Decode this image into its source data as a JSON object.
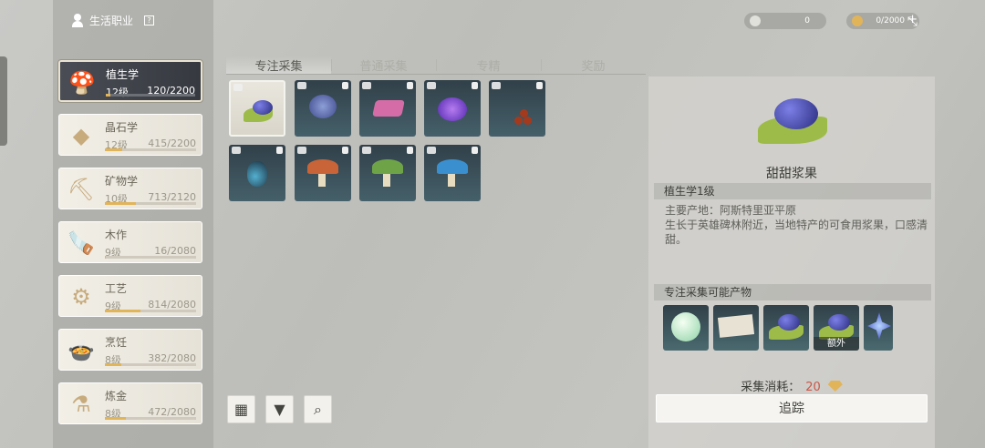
{
  "header": {
    "title": "生活职业",
    "help": "?"
  },
  "resources": [
    {
      "value": "0",
      "icon": "ore-icon",
      "color": "#e1e1dc"
    },
    {
      "value": "0/2000",
      "icon": "diamond-icon",
      "color": "#e2b45a",
      "plus": "+"
    }
  ],
  "fullscreen_icon": "fullscreen-icon",
  "skills": [
    {
      "name": "植生学",
      "level": "12级",
      "xp": "120/2200",
      "progress": 0.055,
      "icon": "mushroom-icon",
      "active": true
    },
    {
      "name": "晶石学",
      "level": "12级",
      "xp": "415/2200",
      "progress": 0.19,
      "icon": "crystal-icon"
    },
    {
      "name": "矿物学",
      "level": "10级",
      "xp": "713/2120",
      "progress": 0.34,
      "icon": "pickaxe-icon"
    },
    {
      "name": "木作",
      "level": "9级",
      "xp": "16/2080",
      "progress": 0.01,
      "icon": "saw-icon"
    },
    {
      "name": "工艺",
      "level": "9级",
      "xp": "814/2080",
      "progress": 0.39,
      "icon": "craft-icon"
    },
    {
      "name": "烹饪",
      "level": "8级",
      "xp": "382/2080",
      "progress": 0.18,
      "icon": "pot-icon"
    },
    {
      "name": "炼金",
      "level": "8级",
      "xp": "472/2080",
      "progress": 0.23,
      "icon": "flask-icon"
    }
  ],
  "tabs": [
    {
      "label": "专注采集",
      "active": true
    },
    {
      "label": "普通采集"
    },
    {
      "label": "专精"
    },
    {
      "label": "奖励"
    }
  ],
  "items": [
    {
      "icon": "sweet-berry-icon",
      "selected": true
    },
    {
      "icon": "blue-flower-icon"
    },
    {
      "icon": "pink-flower-icon"
    },
    {
      "icon": "purple-flower-icon"
    },
    {
      "icon": "red-berry-branch-icon"
    },
    {
      "icon": "beetle-icon"
    },
    {
      "icon": "orange-mushroom-icon"
    },
    {
      "icon": "green-mushroom-icon"
    },
    {
      "icon": "blue-mushroom-icon"
    }
  ],
  "tools": [
    "grid-view-icon",
    "filter-icon",
    "search-icon"
  ],
  "detail": {
    "name": "甜甜浆果",
    "requirement": "植生学1级",
    "origin": "主要产地：阿斯特里亚平原",
    "description": "生长于英雄碑林附近，当地特产的可食用浆果，口感清甜。",
    "products_title": "专注采集可能产物",
    "products": [
      {
        "icon": "green-orb-icon"
      },
      {
        "icon": "paper-scroll-icon"
      },
      {
        "icon": "sweet-berry-icon"
      },
      {
        "icon": "sweet-berry-icon",
        "extra": "额外"
      },
      {
        "icon": "blue-crystal-icon"
      }
    ],
    "cost_label": "采集消耗：",
    "cost_value": "20",
    "track_label": "追踪"
  }
}
